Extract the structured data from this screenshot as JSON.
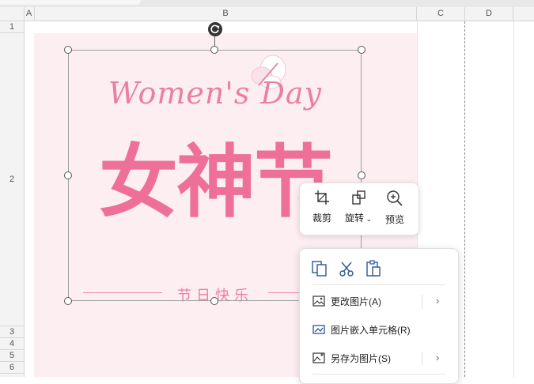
{
  "columns": [
    "A",
    "B",
    "C",
    "D"
  ],
  "rows": [
    "1",
    "2",
    "3",
    "4",
    "5",
    "6"
  ],
  "picture": {
    "script_title": "Women's Day",
    "main_title": "女神节",
    "subtitle": "节日快乐"
  },
  "mini_toolbar": {
    "crop_label": "裁剪",
    "rotate_label": "旋转",
    "preview_label": "预览"
  },
  "context_menu": {
    "items": [
      {
        "label": "更改图片(A)",
        "icon": "change-picture-icon"
      },
      {
        "label": "图片嵌入单元格(R)",
        "icon": "embed-in-cell-icon"
      },
      {
        "label": "另存为图片(S)",
        "icon": "save-as-picture-icon"
      }
    ]
  },
  "colors": {
    "accent_pink": "#ee6f98",
    "picture_background": "#fdeef2",
    "icon_blue": "#2b5797"
  }
}
